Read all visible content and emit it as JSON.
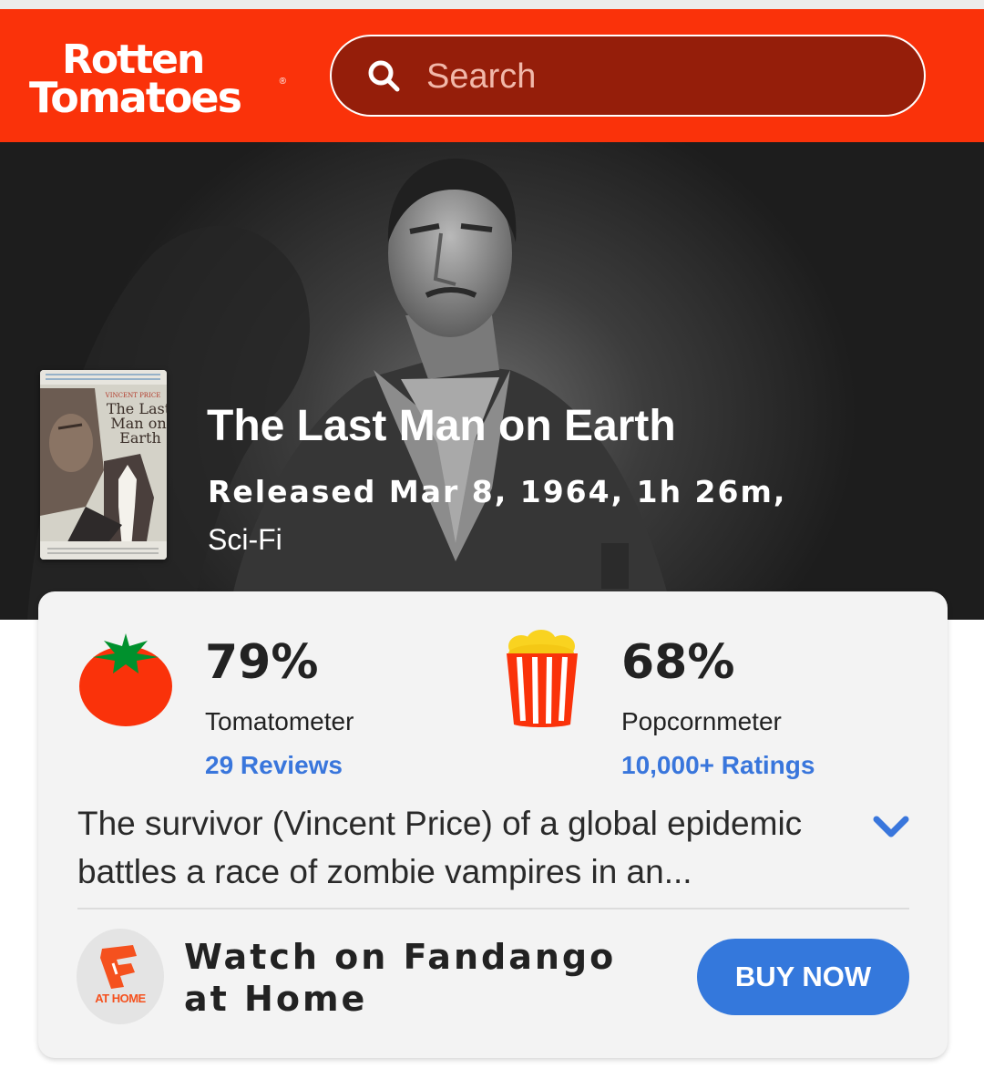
{
  "header": {
    "logo_line1": "Rotten",
    "logo_line2": "Tomatoes",
    "logo_reg": "®",
    "search_placeholder": "Search"
  },
  "movie": {
    "title": "The Last Man on Earth",
    "release_line": "Released Mar 8, 1964, 1h 26m,",
    "genre": "Sci-Fi",
    "poster_lines": {
      "actor": "VINCENT PRICE",
      "title_1": "The Last",
      "title_2": "Man on",
      "title_3": "Earth"
    }
  },
  "scores": {
    "tomatometer": {
      "value": "79%",
      "label": "Tomatometer",
      "link": "29 Reviews"
    },
    "popcornmeter": {
      "value": "68%",
      "label": "Popcornmeter",
      "link": "10,000+ Ratings"
    }
  },
  "synopsis": "The survivor (Vincent Price) of a global epidemic battles a race of zombie vampires in an...",
  "fandango": {
    "badge": "AT HOME",
    "cta_text": "Watch on Fandango at Home",
    "button_label": "BUY NOW"
  },
  "colors": {
    "brand_red": "#fa320a",
    "link_blue": "#3976dc",
    "button_blue": "#3478dc",
    "fandango_orange": "#f5511e"
  },
  "icons": {
    "search": "search-icon",
    "add": "plus-circle-icon",
    "tomato": "tomato-icon",
    "popcorn": "popcorn-icon",
    "expand": "chevron-down-icon",
    "fandango": "fandango-logo-icon"
  }
}
